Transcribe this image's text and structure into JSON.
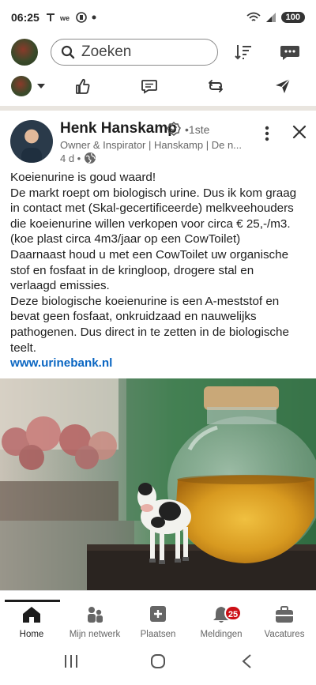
{
  "status_bar": {
    "time": "06:25",
    "battery": "100"
  },
  "header": {
    "search_placeholder": "Zoeken"
  },
  "post": {
    "author": "Henk Hanskamp",
    "degree": "•1ste",
    "headline": "Owner & Inspirator | Hanskamp | De n...",
    "time": "4 d •",
    "lines": [
      "Koeienurine is goud waard!",
      "De markt roept om biologisch urine. Dus ik kom graag",
      "in contact met (Skal-gecertificeerde) melkveehouders",
      "die koeienurine willen verkopen voor circa € 25,-/m3.",
      "(koe plast circa 4m3/jaar op een CowToilet)",
      "Daarnaast houd u met een CowToilet uw organische",
      "stof en fosfaat in de kringloop, drogere stal en",
      "verlaagd emissies.",
      "Deze biologische koeienurine is een A-meststof en",
      "bevat geen fosfaat, onkruidzaad en nauwelijks",
      "pathogenen. Dus direct in te zetten in de biologische",
      "teelt."
    ],
    "link": "www.urinebank.nl"
  },
  "nav": {
    "items": [
      {
        "label": "Home",
        "icon": "home-icon"
      },
      {
        "label": "Mijn netwerk",
        "icon": "network-icon"
      },
      {
        "label": "Plaatsen",
        "icon": "post-icon"
      },
      {
        "label": "Meldingen",
        "icon": "bell-icon"
      },
      {
        "label": "Vacatures",
        "icon": "briefcase-icon"
      }
    ],
    "notifications_badge": "25"
  },
  "colors": {
    "link": "#0a66c2",
    "badge": "#cc1016"
  }
}
